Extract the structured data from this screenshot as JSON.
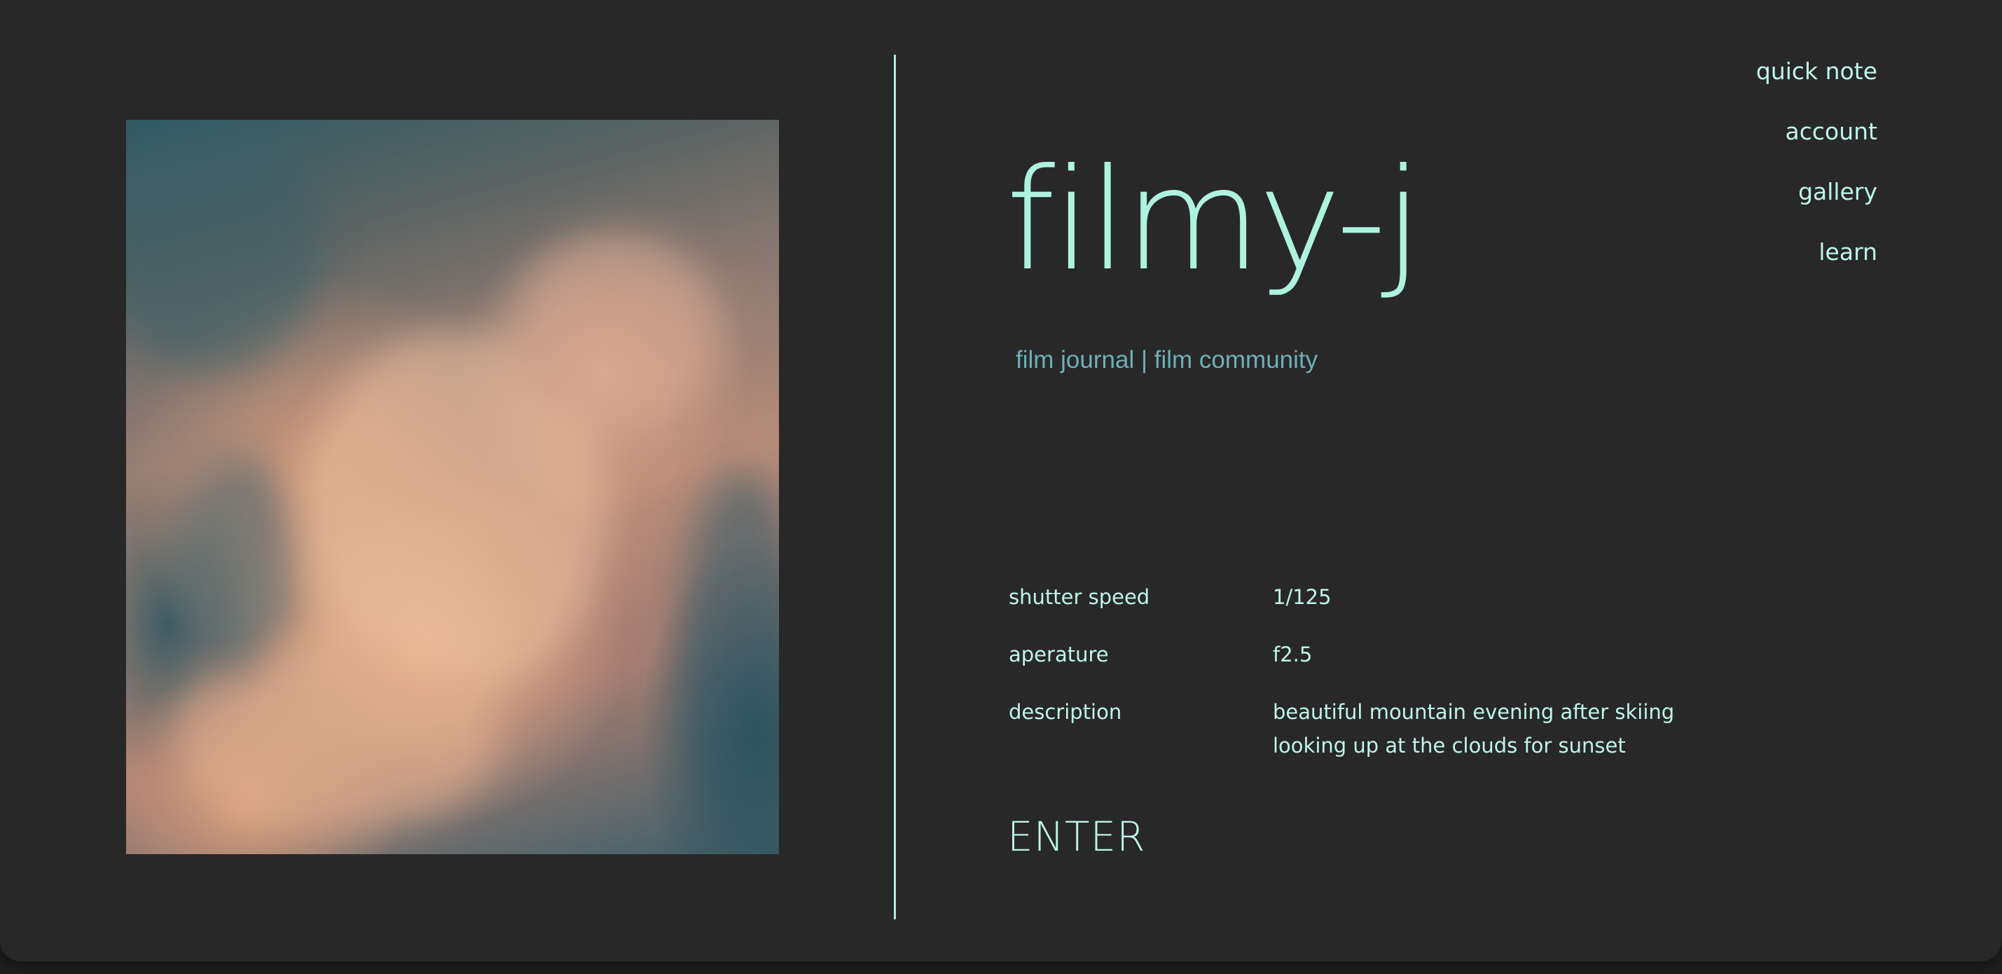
{
  "brand": {
    "title": "filmy-j",
    "subtitle": "film journal | film community"
  },
  "nav": {
    "items": [
      {
        "label": "quick note"
      },
      {
        "label": "account"
      },
      {
        "label": "gallery"
      },
      {
        "label": "learn"
      }
    ]
  },
  "details": {
    "shutter_label": "shutter speed",
    "shutter_value": "1/125",
    "aperture_label": "aperature",
    "aperture_value": "f2.5",
    "description_label": "description",
    "description_lines": [
      "beautiful mountain evening after skiing",
      "looking up at the clouds for sunset"
    ]
  },
  "enter_label": "ENTER",
  "colors": {
    "background": "#282828",
    "accent": "#aef3e0",
    "subtitle": "#6fb0b6"
  }
}
